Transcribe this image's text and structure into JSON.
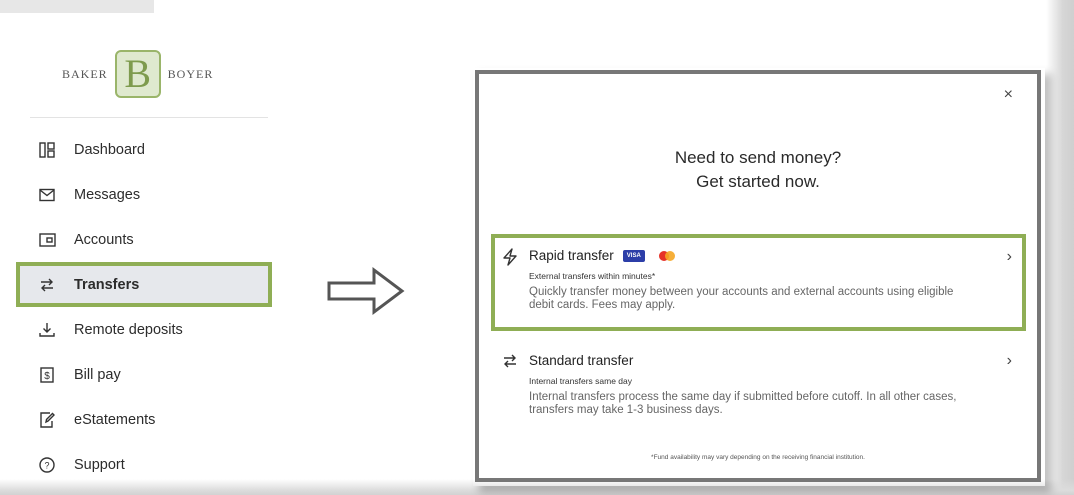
{
  "brand": {
    "left_word": "BAKER",
    "right_word": "BOYER",
    "monogram": "B"
  },
  "sidebar": {
    "items": [
      {
        "label": "Dashboard",
        "icon": "dashboard-icon"
      },
      {
        "label": "Messages",
        "icon": "envelope-icon"
      },
      {
        "label": "Accounts",
        "icon": "accounts-icon"
      },
      {
        "label": "Transfers",
        "icon": "transfer-arrows-icon",
        "active": true
      },
      {
        "label": "Remote deposits",
        "icon": "download-tray-icon"
      },
      {
        "label": "Bill pay",
        "icon": "dollar-bill-icon"
      },
      {
        "label": "eStatements",
        "icon": "edit-document-icon"
      },
      {
        "label": "Support",
        "icon": "help-circle-icon"
      }
    ]
  },
  "modal": {
    "close_glyph": "×",
    "heading_line1": "Need to send money?",
    "heading_line2": "Get started now.",
    "options": [
      {
        "title": "Rapid transfer",
        "subtitle": "External transfers within minutes*",
        "description": "Quickly transfer money between your accounts and external accounts using eligible debit cards. Fees may apply.",
        "card_badge": "VISA",
        "icon": "lightning-icon"
      },
      {
        "title": "Standard transfer",
        "subtitle": "Internal transfers same day",
        "description": "Internal transfers process the same day if submitted before cutoff. In all other cases, transfers may take 1-3 business days.",
        "icon": "transfer-arrows-icon"
      }
    ],
    "footnote": "*Fund availability may vary depending on the receiving financial institution."
  },
  "colors": {
    "highlight_green": "#8fae55",
    "modal_border": "#777777",
    "active_bg": "#e6e8ec"
  }
}
